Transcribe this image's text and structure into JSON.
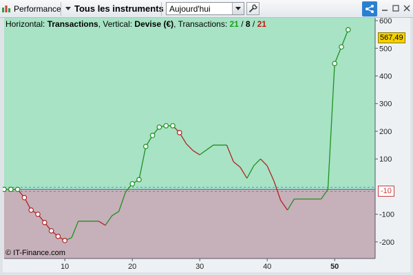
{
  "toolbar": {
    "app_label": "Performance",
    "instruments_label": "Tous les instruments",
    "period_value": "Aujourd'hui",
    "icons": [
      "chart-icon",
      "dropdown-arrow-icon",
      "wrench-icon",
      "share-icon",
      "minimize-icon",
      "maximize-icon",
      "close-icon"
    ]
  },
  "info": {
    "prefix": "Horizontal: ",
    "horizontal": "Transactions",
    "vertical_prefix": ", Vertical: ",
    "vertical": "Devise (€)",
    "transactions_prefix": ", Transactions: ",
    "t_total": "21",
    "slash1": " / ",
    "t_mid": "8",
    "slash2": " / ",
    "t_last": "21"
  },
  "badges": {
    "last_value": "567,49",
    "zero_value": "-10"
  },
  "copyright": "© IT-Finance.com",
  "colors": {
    "profit_zone": "#a7e3c4",
    "loss_zone": "#c6b0b9",
    "gain_line": "#1f8f1f",
    "loss_line": "#b22222",
    "zero_line": "#3b6fd6"
  },
  "chart_data": {
    "type": "line",
    "x_ticks": [
      "10",
      "20",
      "30",
      "40",
      "50"
    ],
    "y_ticks": [
      "600",
      "500",
      "400",
      "300",
      "200",
      "100",
      "-100",
      "-200"
    ],
    "xlim": [
      1,
      56
    ],
    "ylim": [
      -260,
      610
    ],
    "zero_value": -10,
    "points": [
      [
        1,
        -10
      ],
      [
        2,
        -10
      ],
      [
        3,
        -10
      ],
      [
        4,
        -40
      ],
      [
        5,
        -85
      ],
      [
        6,
        -100
      ],
      [
        7,
        -130
      ],
      [
        8,
        -160
      ],
      [
        9,
        -180
      ],
      [
        10,
        -195
      ],
      [
        11,
        -185
      ],
      [
        12,
        -125
      ],
      [
        15,
        -125
      ],
      [
        16,
        -140
      ],
      [
        17,
        -105
      ],
      [
        18,
        -90
      ],
      [
        19,
        -20
      ],
      [
        20,
        10
      ],
      [
        21,
        25
      ],
      [
        22,
        145
      ],
      [
        23,
        185
      ],
      [
        24,
        215
      ],
      [
        25,
        220
      ],
      [
        26,
        220
      ],
      [
        27,
        195
      ],
      [
        28,
        155
      ],
      [
        29,
        130
      ],
      [
        30,
        115
      ],
      [
        32,
        150
      ],
      [
        34,
        150
      ],
      [
        35,
        90
      ],
      [
        36,
        70
      ],
      [
        37,
        30
      ],
      [
        38,
        75
      ],
      [
        39,
        100
      ],
      [
        40,
        75
      ],
      [
        41,
        20
      ],
      [
        42,
        -50
      ],
      [
        43,
        -85
      ],
      [
        44,
        -45
      ],
      [
        48,
        -45
      ],
      [
        49,
        -10
      ],
      [
        50,
        445
      ],
      [
        51,
        505
      ],
      [
        52,
        567
      ]
    ],
    "marker_x": [
      1,
      2,
      3,
      4,
      5,
      6,
      7,
      8,
      9,
      10,
      20,
      21,
      22,
      23,
      24,
      25,
      26,
      27,
      50,
      51,
      52
    ]
  }
}
